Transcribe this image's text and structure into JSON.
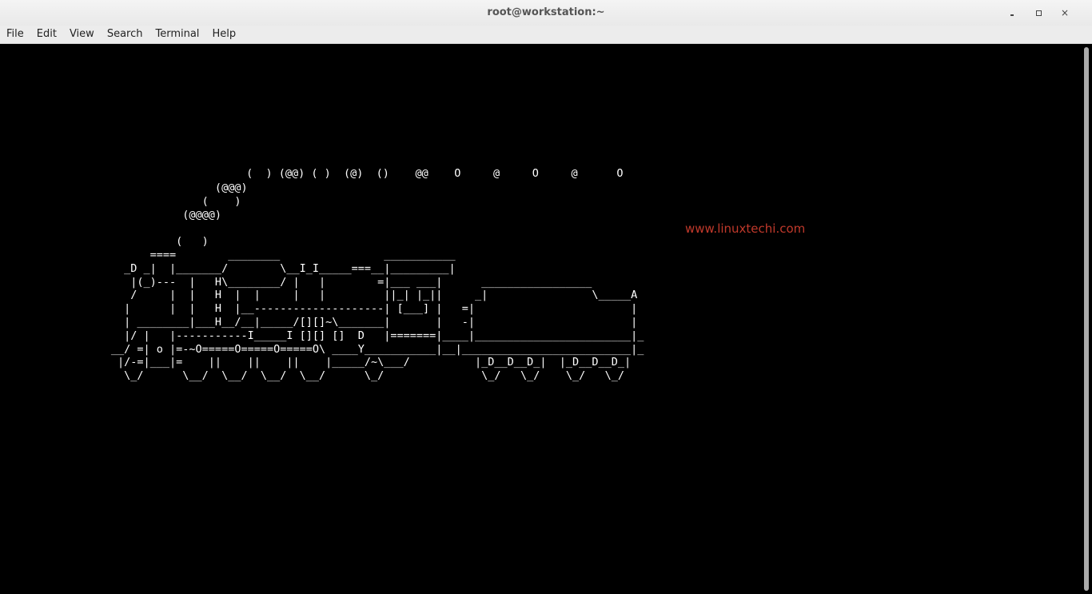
{
  "window": {
    "title": "root@workstation:~",
    "controls": {
      "minimize_icon": "minimize-icon",
      "maximize_icon": "maximize-icon",
      "close_icon": "close-icon",
      "close_glyph": "×"
    }
  },
  "menubar": {
    "items": [
      {
        "label": "File"
      },
      {
        "label": "Edit"
      },
      {
        "label": "View"
      },
      {
        "label": "Search"
      },
      {
        "label": "Terminal"
      },
      {
        "label": "Help"
      }
    ]
  },
  "terminal": {
    "smoke_line": " (  ) (@@) ( )  (@)  ()    @@    O     @     O     @      O",
    "train_art": "                       (@@@)\n                     (    )\n                  (@@@@)\n\n                 (   )\n             ====        ________                ___________\n         _D _|  |_______/        \\__I_I_____===__|_________|\n          |(_)---  |   H\\________/ |   |        =|___ ___|      _________________\n          /     |  |   H  |  |     |   |         ||_| |_||     _|                \\_____A\n         |      |  |   H  |__--------------------| [___] |   =|                        |\n         | ________|___H__/__|_____/[][]~\\_______|       |   -|                        |\n         |/ |   |-----------I_____I [][] []  D   |=======|____|________________________|_\n       __/ =| o |=-~O=====O=====O=====O\\ ____Y___________|__|__________________________|_\n        |/-=|___|=    ||    ||    ||    |_____/~\\___/          |_D__D__D_|  |_D__D__D_|\n         \\_/      \\__/  \\__/  \\__/  \\__/      \\_/               \\_/   \\_/    \\_/   \\_/",
    "watermark": "www.linuxtechi.com",
    "text_color": "#ffffff",
    "background_color": "#000000",
    "watermark_color": "#c0392b"
  }
}
